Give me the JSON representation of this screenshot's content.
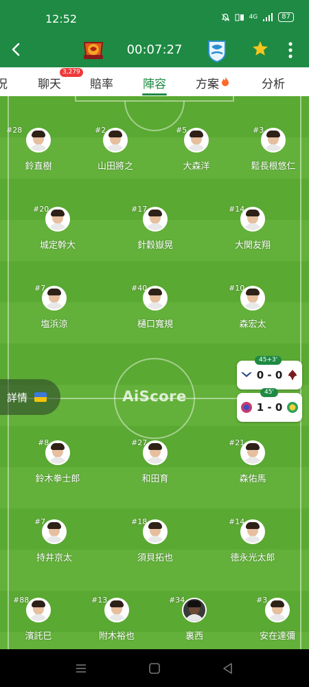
{
  "status_bar": {
    "time": "12:52",
    "network": "4G",
    "battery": "87"
  },
  "header": {
    "match_clock": "00:07:27",
    "icons": [
      "back-icon",
      "home-team-logo",
      "away-team-logo",
      "star-icon",
      "more-icon"
    ]
  },
  "tabs": [
    {
      "label": "況"
    },
    {
      "label": "聊天",
      "badge": "3,279"
    },
    {
      "label": "賠率"
    },
    {
      "label": "陣容",
      "active": true
    },
    {
      "label": "方案",
      "icon": "fire-icon"
    },
    {
      "label": "分析"
    }
  ],
  "pitch": {
    "watermark": "AiScore",
    "details_button": "詳情",
    "top_team_players": [
      {
        "number": "#28",
        "name": "鈴直樹"
      },
      {
        "number": "#2",
        "name": "山田將之"
      },
      {
        "number": "#5",
        "name": "大森洋"
      },
      {
        "number": "#3",
        "name": "鬆長根悠仁"
      },
      {
        "number": "#20",
        "name": "城定幹大"
      },
      {
        "number": "#17",
        "name": "針穀嶽晃"
      },
      {
        "number": "#14",
        "name": "大関友翔"
      },
      {
        "number": "#7",
        "name": "塩浜涼"
      },
      {
        "number": "#40",
        "name": "樋口寬規"
      },
      {
        "number": "#10",
        "name": "森宏太"
      }
    ],
    "bottom_team_players": [
      {
        "number": "#8",
        "name": "鈴木拳士郎"
      },
      {
        "number": "#27",
        "name": "和田育"
      },
      {
        "number": "#21",
        "name": "森佑馬"
      },
      {
        "number": "#7",
        "name": "持井京太"
      },
      {
        "number": "#18",
        "name": "須貝拓也"
      },
      {
        "number": "#14",
        "name": "徳永光太郎"
      },
      {
        "number": "#88",
        "name": "濱託巳"
      },
      {
        "number": "#13",
        "name": "附木裕也"
      },
      {
        "number": "#34",
        "name": "裏西"
      },
      {
        "number": "#3",
        "name": "安在達彌"
      }
    ]
  },
  "live_scores": [
    {
      "minute": "45+3'",
      "score": "0 - 0"
    },
    {
      "minute": "45'",
      "score": "1 - 0"
    }
  ],
  "colors": {
    "primary": "#1e8a43",
    "pitch_dark": "#5aa932",
    "pitch_light": "#63b13a",
    "badge": "#ee3b3b",
    "star": "#f7c51e"
  },
  "nav_bar": {
    "icons": [
      "menu-icon",
      "home-icon",
      "back-triangle-icon"
    ]
  }
}
